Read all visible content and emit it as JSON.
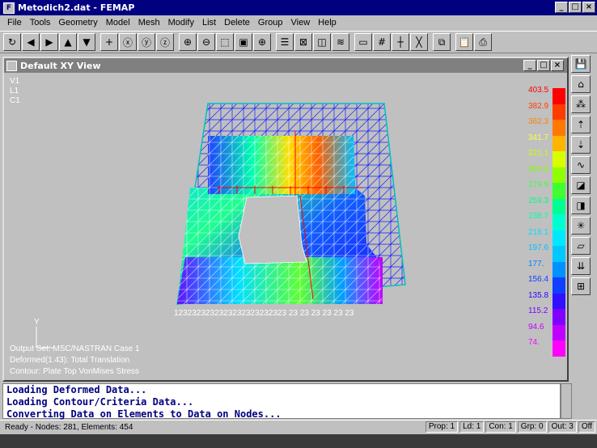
{
  "window": {
    "title": "Metodich2.dat - FEMAP",
    "icon": "femap-icon"
  },
  "menu": [
    "File",
    "Tools",
    "Geometry",
    "Model",
    "Mesh",
    "Modify",
    "List",
    "Delete",
    "Group",
    "View",
    "Help"
  ],
  "toolbar_icons": [
    "circle-arrow-icon",
    "arrow-left-icon",
    "arrow-right-icon",
    "arrow-up-icon",
    "arrow-down-icon",
    "plus-icon",
    "rotate-x-icon",
    "rotate-y-icon",
    "rotate-z-icon",
    "zoom-in-icon",
    "zoom-out-icon",
    "box-zoom-icon",
    "fit-icon",
    "center-icon",
    "list-icon",
    "grid-box-icon",
    "cube-icon",
    "layers-icon",
    "window-icon",
    "grid-icon",
    "cross-icon",
    "x-icon",
    "copy-icon",
    "clipboard-icon",
    "print-icon"
  ],
  "child_window": {
    "title": "Default XY View"
  },
  "view_labels": {
    "v": "V1",
    "l": "L1",
    "c": "C1"
  },
  "axis_label": "Y",
  "info_lines": [
    "Output Set: MSC/NASTRAN Case 1",
    "Deformed(1.43): Total Translation",
    "Contour: Plate Top VonMises Stress"
  ],
  "node_labels": "1232323232323232323232323 23 23 23 23 23 23",
  "legend": {
    "values": [
      "403.5",
      "382.9",
      "362.3",
      "341.7",
      "321.1",
      "300.5",
      "279.9",
      "259.3",
      "238.7",
      "218.1",
      "197.6",
      "177.",
      "156.4",
      "135.8",
      "115.2",
      "94.6",
      "74."
    ],
    "colors": [
      "#ff0000",
      "#ff3c00",
      "#ff7800",
      "#ffb400",
      "#d8ff00",
      "#90ff00",
      "#40ff30",
      "#00ff90",
      "#00ffd0",
      "#00e8ff",
      "#00c8ff",
      "#0090ff",
      "#1040ff",
      "#3010ff",
      "#8000ff",
      "#c000ff",
      "#ff00ff"
    ],
    "text_colors": [
      "#ff0000",
      "#ff4000",
      "#ff8000",
      "#ffff40",
      "#c8ff00",
      "#80ff00",
      "#40ff40",
      "#00ff80",
      "#00ffb0",
      "#00e0ff",
      "#00c0ff",
      "#0080ff",
      "#1040ff",
      "#3000ff",
      "#8000ff",
      "#c000ff",
      "#ff00ff"
    ]
  },
  "output_lines": [
    "Loading Deformed Data...",
    "Loading Contour/Criteria Data...",
    "Converting Data on Elements to Data on Nodes..."
  ],
  "status": {
    "text": "Ready - Nodes: 281,  Elements: 454",
    "prop": "Prop: 1",
    "ld": "Ld: 1",
    "con": "Con: 1",
    "grp": "Grp: 0",
    "out": "Out: 3",
    "off": "Off"
  },
  "right_toolbar_icons": [
    "save-icon",
    "house-icon",
    "mesh-icon",
    "node-up-icon",
    "node-down-icon",
    "curve-icon",
    "solid-icon",
    "box3d-icon",
    "explode-icon",
    "plane-icon",
    "merge-icon",
    "panel-icon"
  ]
}
